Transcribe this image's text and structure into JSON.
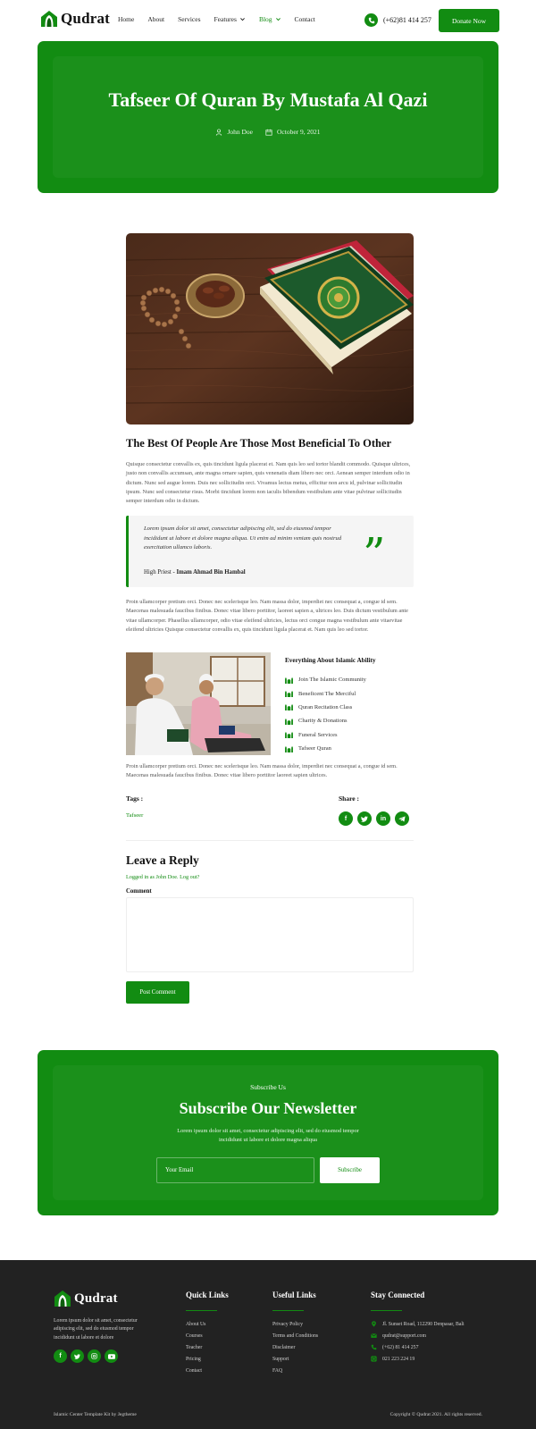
{
  "colors": {
    "brand": "#128c12",
    "footer_bg": "#222222",
    "white": "#ffffff"
  },
  "header": {
    "logo_text": "Qudrat",
    "nav": [
      {
        "label": "Home",
        "dropdown": false,
        "active": false
      },
      {
        "label": "About",
        "dropdown": false,
        "active": false
      },
      {
        "label": "Services",
        "dropdown": false,
        "active": false
      },
      {
        "label": "Features",
        "dropdown": true,
        "active": false
      },
      {
        "label": "Blog",
        "dropdown": true,
        "active": true
      },
      {
        "label": "Contact",
        "dropdown": false,
        "active": false
      }
    ],
    "phone": "(+62)81 414 257",
    "donate_label": "Donate Now"
  },
  "hero": {
    "title": "Tafseer Of Quran By Mustafa Al Qazi",
    "author": "John Doe",
    "date": "October 9, 2021"
  },
  "article": {
    "title": "The Best Of People Are Those Most Beneficial To Other",
    "paragraph1": "Quisque consectetur convallis ex, quis tincidunt ligula placerat et. Nam quis leo sed tortor blandit commodo. Quisque ultrices, justo non convallis accumsan, ante magna ornare sapien, quis venenatis diam libero nec orci. Aenean semper interdum odio in dictum. Nunc sed augue lorem. Duis nec sollicitudin orci. Vivamus lectus metus, efficitur non arcu id, pulvinar sollicitudin ipsum. Nunc sed consectetur risus. Morbi tincidunt lorem non iaculis bibendum vestibulum ante vitae pulvinar sollicitudin semper interdum odio in dictum.",
    "quote": "Lorem ipsum dolor sit amet, consectetur adipiscing elit, sed do eiusmod tempor incididunt ut labore et dolore magna aliqua. Ut enim ad minim veniam quis nostrud exercitation ullamco laboris.",
    "quote_author_prefix": "High Priest - ",
    "quote_author_name": "Imam Ahmad Bin Hambal",
    "paragraph2": "Proin ullamcorper pretium orci. Donec nec scelerisque leo. Nam massa dolor, imperdiet nec consequat a, congue id sem. Maecenas malesuada faucibus finibus. Donec vitae libero porttitor, laoreet sapien a, ultrices leo. Duis dictum vestibulum ante vitae ullamcorper. Phasellus ullamcorper, odio vitae eleifend ultricies, lectus orci congue magna vestibulum ante vitaevitae eleifend ultricies Quisque consectetur convallis ex, quis tincidunt ligula placerat et. Nam quis leo sed tortor.",
    "ability_title": "Everything About Islamic Ability",
    "ability_items": [
      "Join The Islamic Community",
      "Beneficent The Merciful",
      "Quran Recitation Class",
      "Charity & Donations",
      "Funeral Services",
      "Tafseer Quran"
    ],
    "paragraph3": "Proin ullamcorper pretium orci. Donec nec scelerisque leo. Nam massa dolor, imperdiet nec consequat a, congue id sem. Maecenas malesuada faucibus finibus. Donec vitae libero porttitor laoreet sapien ultrices.",
    "tags_label": "Tags :",
    "tag": "Tafseer",
    "share_label": "Share :",
    "share_icons": [
      "facebook-icon",
      "twitter-icon",
      "linkedin-icon",
      "telegram-icon"
    ]
  },
  "reply": {
    "title": "Leave a Reply",
    "logged_in": "Logged in as John Doe. Log out?",
    "comment_label": "Comment",
    "comment_value": "",
    "post_label": "Post Comment"
  },
  "newsletter": {
    "kicker": "Subscribe Us",
    "title": "Subscribe Our Newsletter",
    "description": "Lorem ipsum dolor sit amet, consectetur adipiscing elit, sed do eiusmod tempor incididunt ut labore et dolore magna aliqua",
    "email_placeholder": "Your Email",
    "button": "Subscribe"
  },
  "footer": {
    "logo_text": "Qudrat",
    "description": "Lorem ipsum dolor sit amet, consectetur adipiscing elit, sed do eiusmod tempor incididunt ut labore et dolore",
    "social": [
      "facebook-icon",
      "twitter-icon",
      "instagram-icon",
      "youtube-icon"
    ],
    "quick_links": {
      "title": "Quick Links",
      "items": [
        "About Us",
        "Courses",
        "Teacher",
        "Pricing",
        "Contact"
      ]
    },
    "useful_links": {
      "title": "Useful Links",
      "items": [
        "Privacy Policy",
        "Terms and Conditions",
        "Disclaimer",
        "Support",
        "FAQ"
      ]
    },
    "stay_connected": {
      "title": "Stay Connected",
      "items": [
        {
          "icon": "location-icon",
          "text": "Jl. Sunset Road, 112290 Denpasar, Bali"
        },
        {
          "icon": "mail-icon",
          "text": "qudrat@support.com"
        },
        {
          "icon": "phone-icon",
          "text": "(+62) 81 414 257"
        },
        {
          "icon": "whatsapp-icon",
          "text": "021 223 224 19"
        }
      ]
    },
    "bottom_left": "Islamic Center Template Kit by Jegtheme",
    "bottom_right": "Copyright © Qudrat 2021. All rights reserved."
  }
}
